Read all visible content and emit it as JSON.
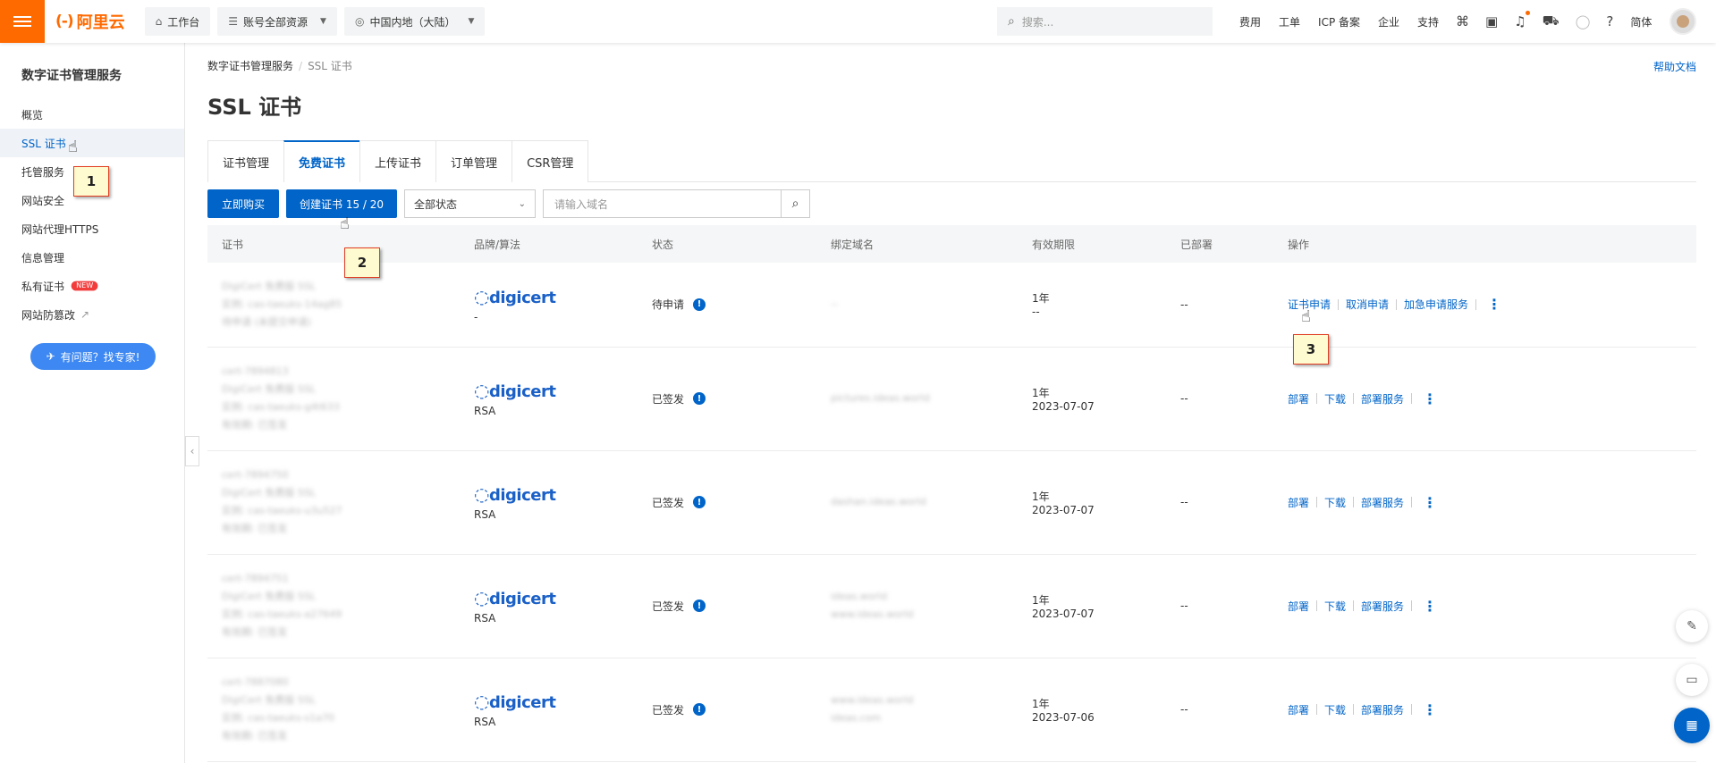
{
  "topbar": {
    "logo_text": "阿里云",
    "workbench": "工作台",
    "resources": "账号全部资源",
    "region": "中国内地（大陆）",
    "search_placeholder": "搜索...",
    "links": [
      "费用",
      "工单",
      "ICP 备案",
      "企业",
      "支持"
    ],
    "lang": "简体"
  },
  "sidebar": {
    "title": "数字证书管理服务",
    "items": [
      {
        "label": "概览"
      },
      {
        "label": "SSL 证书"
      },
      {
        "label": "托管服务"
      },
      {
        "label": "网站安全"
      },
      {
        "label": "网站代理HTTPS"
      },
      {
        "label": "信息管理"
      },
      {
        "label": "私有证书",
        "badge": "NEW"
      },
      {
        "label": "网站防篡改"
      }
    ],
    "expert_button": "有问题？找专家!"
  },
  "main": {
    "breadcrumb": [
      "数字证书管理服务",
      "SSL 证书"
    ],
    "help_link": "帮助文档",
    "title": "SSL 证书",
    "tabs": [
      "证书管理",
      "免费证书",
      "上传证书",
      "订单管理",
      "CSR管理"
    ],
    "toolbar": {
      "buy_button": "立即购买",
      "create_button": "创建证书 15 / 20",
      "status_select": "全部状态",
      "domain_placeholder": "请输入域名"
    },
    "table": {
      "headers": [
        "证书",
        "品牌/算法",
        "状态",
        "绑定域名",
        "有效期限",
        "已部署",
        "操作"
      ],
      "rows": [
        {
          "cert": [
            "DigiCert 免费版 SSL",
            "实例: cas-taeuks-14ag85",
            "待申请 (未提交申请)"
          ],
          "brand": "digicert",
          "alg": "-",
          "status": "待申请",
          "domain": [
            "--"
          ],
          "validity": "1年",
          "expires": "--",
          "deployed": "--",
          "ops": [
            "证书申请",
            "取消申请",
            "加急申请服务"
          ]
        },
        {
          "cert": [
            "cert-7894813",
            "DigiCert 免费版 SSL",
            "实例: cas-taeuks-g4t633",
            "有效期: 已签发"
          ],
          "brand": "digicert",
          "alg": "RSA",
          "status": "已签发",
          "domain": [
            "pictures.ideas.world"
          ],
          "validity": "1年",
          "expires": "2023-07-07",
          "deployed": "--",
          "ops": [
            "部署",
            "下载",
            "部署服务"
          ]
        },
        {
          "cert": [
            "cert-7894750",
            "DigiCert 免费版 SSL",
            "实例: cas-taeuks-u3u527",
            "有效期: 已签发"
          ],
          "brand": "digicert",
          "alg": "RSA",
          "status": "已签发",
          "domain": [
            "dashan.ideas.world"
          ],
          "validity": "1年",
          "expires": "2023-07-07",
          "deployed": "--",
          "ops": [
            "部署",
            "下载",
            "部署服务"
          ]
        },
        {
          "cert": [
            "cert-7894751",
            "DigiCert 免费版 SSL",
            "实例: cas-taeuks-a27649",
            "有效期: 已签发"
          ],
          "brand": "digicert",
          "alg": "RSA",
          "status": "已签发",
          "domain": [
            "ideas.world",
            "www.ideas.world"
          ],
          "validity": "1年",
          "expires": "2023-07-07",
          "deployed": "--",
          "ops": [
            "部署",
            "下载",
            "部署服务"
          ]
        },
        {
          "cert": [
            "cert-7887080",
            "DigiCert 免费版 SSL",
            "实例: cas-taeuks-s1a70",
            "有效期: 已签发"
          ],
          "brand": "digicert",
          "alg": "RSA",
          "status": "已签发",
          "domain": [
            "www.ideas.world",
            "ideas.com"
          ],
          "validity": "1年",
          "expires": "2023-07-06",
          "deployed": "--",
          "ops": [
            "部署",
            "下载",
            "部署服务"
          ]
        }
      ]
    }
  },
  "annotations": [
    "1",
    "2",
    "3"
  ]
}
